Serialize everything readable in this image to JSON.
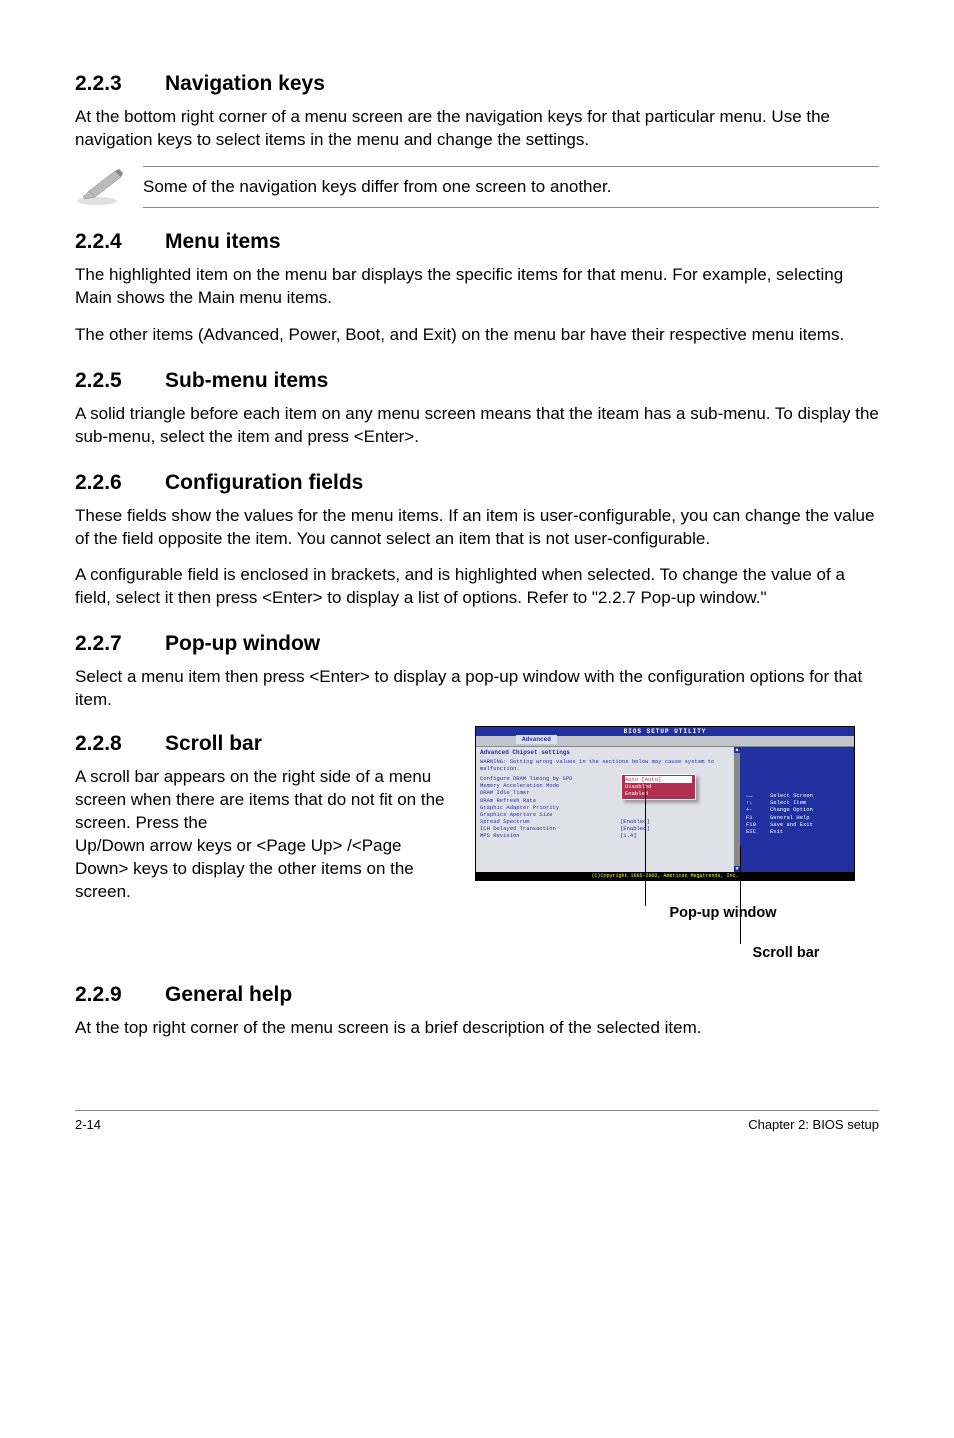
{
  "sections": {
    "s223": {
      "num": "2.2.3",
      "title": "Navigation keys",
      "p1": "At the bottom right corner of a menu screen are the navigation keys for that particular menu. Use the navigation keys to select items in the menu and change the settings.",
      "note": "Some of the navigation keys differ from one screen to another."
    },
    "s224": {
      "num": "2.2.4",
      "title": "Menu items",
      "p1": "The highlighted item on the menu bar  displays the specific items for that menu. For example, selecting Main shows the Main menu items.",
      "p2": "The other items (Advanced, Power, Boot, and Exit) on the menu bar have their respective menu items."
    },
    "s225": {
      "num": "2.2.5",
      "title": "Sub-menu items",
      "p1": "A solid triangle before each item on any menu screen means that the iteam has a sub-menu. To display the sub-menu, select the item and press <Enter>."
    },
    "s226": {
      "num": "2.2.6",
      "title": "Configuration fields",
      "p1": "These fields show the values for the menu items. If an item is user-configurable, you can change the value of the field opposite the item. You cannot select an item that is not user-configurable.",
      "p2": "A configurable field is enclosed in brackets, and is highlighted when selected. To change the value of a field, select it then press <Enter> to display a list of options. Refer to \"2.2.7 Pop-up window.\""
    },
    "s227": {
      "num": "2.2.7",
      "title": "Pop-up window",
      "p1": "Select a menu item then press <Enter> to display a pop-up window with the configuration options for that item."
    },
    "s228": {
      "num": "2.2.8",
      "title": "Scroll bar",
      "p1": "A scroll bar appears on the right side of a menu screen when there are items that do not fit on the screen. Press the",
      "p1b": "Up/Down arrow keys or <Page Up> /<Page Down> keys to display the other items on the screen."
    },
    "s229": {
      "num": "2.2.9",
      "title": "General help",
      "p1": "At the top right corner of the menu screen is a brief description of the selected item."
    }
  },
  "bios": {
    "title": "BIOS SETUP UTILITY",
    "tab": "Advanced",
    "section_title": "Advanced Chipset settings",
    "warning": "WARNING: Setting wrong values in the sections below may cause system to malfunction.",
    "rows": [
      {
        "lbl": "Configure DRAM Timing by SPD",
        "val": "[Enabled]"
      },
      {
        "lbl": "Memory Acceleration Mode",
        "val": "[Auto]"
      },
      {
        "lbl": "DRAM Idle Timer",
        "val": ""
      },
      {
        "lbl": "DRAm Refresh Rate",
        "val": ""
      },
      {
        "lbl": "",
        "val": ""
      },
      {
        "lbl": "Graphic Adapter Priority",
        "val": ""
      },
      {
        "lbl": "Graphics Aperture Size",
        "val": ""
      },
      {
        "lbl": "Spread Spectrum",
        "val": "[Enabled]"
      },
      {
        "lbl": "",
        "val": ""
      },
      {
        "lbl": "ICH Delayed Transaction",
        "val": "[Enabled]"
      },
      {
        "lbl": "",
        "val": ""
      },
      {
        "lbl": "MPS Revision",
        "val": "[1.4]"
      }
    ],
    "popup": {
      "opt0": "Auto [Auto]",
      "opt1": "Disabled",
      "opt2": "Enabled"
    },
    "help": [
      {
        "k": "←→",
        "t": "Select Screen"
      },
      {
        "k": "↑↓",
        "t": "Select Item"
      },
      {
        "k": "+-",
        "t": "Change Option"
      },
      {
        "k": "F1",
        "t": "General Help"
      },
      {
        "k": "F10",
        "t": "Save and Exit"
      },
      {
        "k": "ESC",
        "t": "Exit"
      }
    ],
    "footer": "(C)Copyright 1985-2002, American Megatrends, Inc."
  },
  "callouts": {
    "popup": "Pop-up window",
    "scrollbar": "Scroll bar"
  },
  "footer": {
    "left": "2-14",
    "right": "Chapter 2: BIOS setup"
  }
}
